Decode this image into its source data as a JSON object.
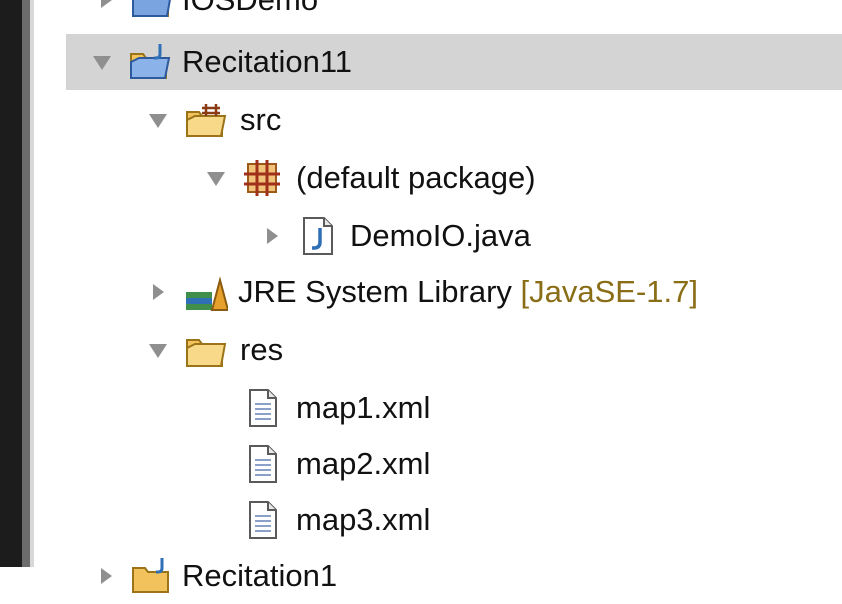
{
  "tree": {
    "items": [
      {
        "label": "IOSDemo",
        "icon": "java-project-folder-icon",
        "state": "collapsed"
      },
      {
        "label": "Recitation11",
        "icon": "java-project-folder-icon",
        "state": "expanded"
      },
      {
        "label": "src",
        "icon": "source-folder-icon",
        "state": "expanded"
      },
      {
        "label": "(default package)",
        "icon": "package-icon",
        "state": "expanded"
      },
      {
        "label": "DemoIO.java",
        "icon": "java-file-icon",
        "state": "collapsed"
      },
      {
        "label": "JRE System Library",
        "suffix": "[JavaSE-1.7]",
        "icon": "library-icon",
        "state": "collapsed"
      },
      {
        "label": "res",
        "icon": "folder-icon",
        "state": "expanded"
      },
      {
        "label": "map1.xml",
        "icon": "text-file-icon"
      },
      {
        "label": "map2.xml",
        "icon": "text-file-icon"
      },
      {
        "label": "map3.xml",
        "icon": "text-file-icon"
      },
      {
        "label": "Recitation1",
        "icon": "java-project-folder-icon",
        "state": "collapsed"
      }
    ]
  },
  "colors": {
    "selection": "#d4d4d4",
    "folder": "#f2c35c",
    "java_blue": "#2e6fb6",
    "library_suffix": "#8a6d17"
  }
}
